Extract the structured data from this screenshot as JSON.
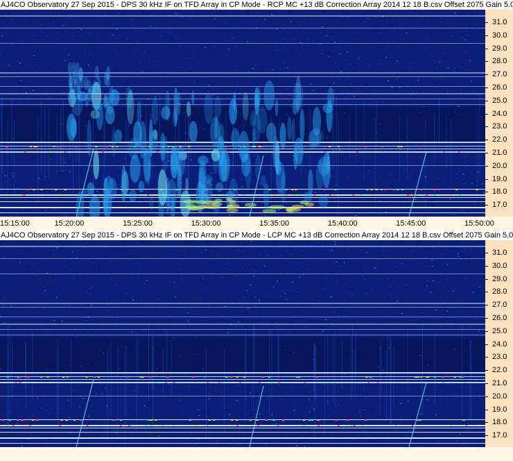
{
  "panels": [
    {
      "title": "AJ4CO Observatory 27 Sep 2015 - DPS 30 kHz IF on TFD Array in CP Mode - RCP  MC +13 dB  Correction Array 2014 12 18 B.csv  Offset 2075  Gain 5.0",
      "freq_labels": [
        "31.0",
        "30.0",
        "29.0",
        "28.0",
        "27.0",
        "26.0",
        "25.0",
        "24.0",
        "23.0",
        "22.0",
        "21.0",
        "20.0",
        "19.0",
        "18.0",
        "17.0"
      ],
      "time_labels": [
        "15:15:00",
        "15:20:00",
        "15:25:00",
        "15:30:00",
        "15:35:00",
        "15:40:00",
        "15:45:00",
        "15:50:00"
      ]
    },
    {
      "title": "AJ4CO Observatory 27 Sep 2015 - DPS 30 kHz IF on TFD Array in CP Mode - LCP  MC +13 dB  Correction Array 2014 12 18 B.csv  Offset 2075  Gain 5.0",
      "freq_labels": [
        "31.0",
        "30.0",
        "29.0",
        "28.0",
        "27.0",
        "26.0",
        "25.0",
        "24.0",
        "23.0",
        "22.0",
        "21.0",
        "20.0",
        "19.0",
        "18.0",
        "17.0"
      ],
      "time_labels": []
    }
  ],
  "colors": {
    "background_noise": "#0a1a6a",
    "axis_panel": "#fde2c2",
    "interference_line": "#dfe9ff",
    "burst_cyan": "#3fc7ff"
  }
}
